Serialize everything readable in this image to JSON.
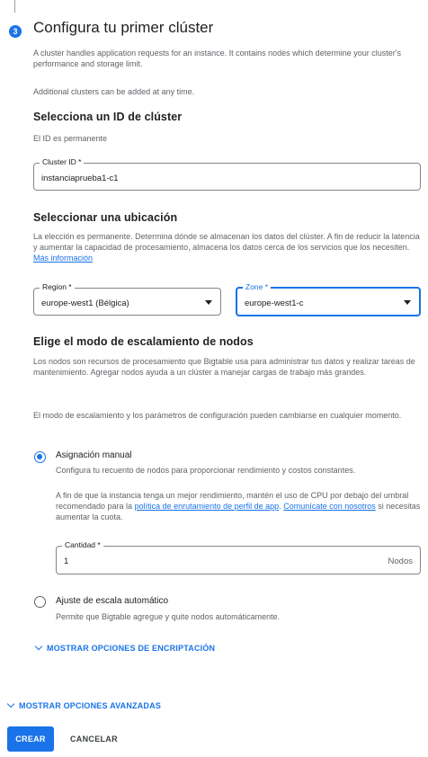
{
  "step": {
    "number": "3",
    "title": "Configura tu primer clúster"
  },
  "intro": {
    "line1": "A cluster handles application requests for an instance. It contains nodes which determine your cluster's performance and storage limit.",
    "line2": "Additional clusters can be added at any time."
  },
  "cluster_id_section": {
    "heading": "Selecciona un ID de clúster",
    "hint": "El ID es permanente",
    "field_label": "Cluster ID *",
    "field_value": "instanciaprueba1-c1"
  },
  "location_section": {
    "heading": "Seleccionar una ubicación",
    "description": "La elección es permanente. Determina dónde se almacenan los datos del clúster. A fin de reducir la latencia y aumentar la capacidad de procesamiento, almacena los datos cerca de los servicios que los necesiten.",
    "link": "Más información",
    "region_label": "Region *",
    "region_value": "europe-west1 (Bélgica)",
    "zone_label": "Zone *",
    "zone_value": "europe-west1-c"
  },
  "scaling_section": {
    "heading": "Elige el modo de escalamiento de nodos",
    "description1": "Los nodos son recursos de procesamiento que Bigtable usa para administrar tus datos y realizar tareas de mantenimiento. Agregar nodos ayuda a un clúster a manejar cargas de trabajo más grandes.",
    "description2": "El modo de escalamiento y los parámetros de configuración pueden cambiarse en cualquier momento.",
    "manual": {
      "label": "Asignación manual",
      "sub": "Configura tu recuento de nodos para proporcionar rendimiento y costos constantes.",
      "info_pre": "A fin de que la instancia tenga un mejor rendimiento, mantén el uso de CPU por debajo del umbral recomendado para la",
      "info_link1": "política de enrutamiento de perfil de app",
      "info_link2": "Comunícate con nosotros",
      "info_post": "si necesitas aumentar la cuota.",
      "quantity_label": "Cantidad *",
      "quantity_value": "1",
      "quantity_suffix": "Nodos"
    },
    "auto": {
      "label": "Ajuste de escala automático",
      "sub": "Permite que Bigtable agregue y quite nodos automáticamente."
    }
  },
  "encryption_toggle": "MOSTRAR OPCIONES DE ENCRIPTACIÓN",
  "advanced_toggle": "MOSTRAR OPCIONES AVANZADAS",
  "buttons": {
    "create": "CREAR",
    "cancel": "CANCELAR"
  },
  "colors": {
    "accent": "#1a73e8",
    "text": "#202124",
    "secondary": "#5f6368"
  }
}
